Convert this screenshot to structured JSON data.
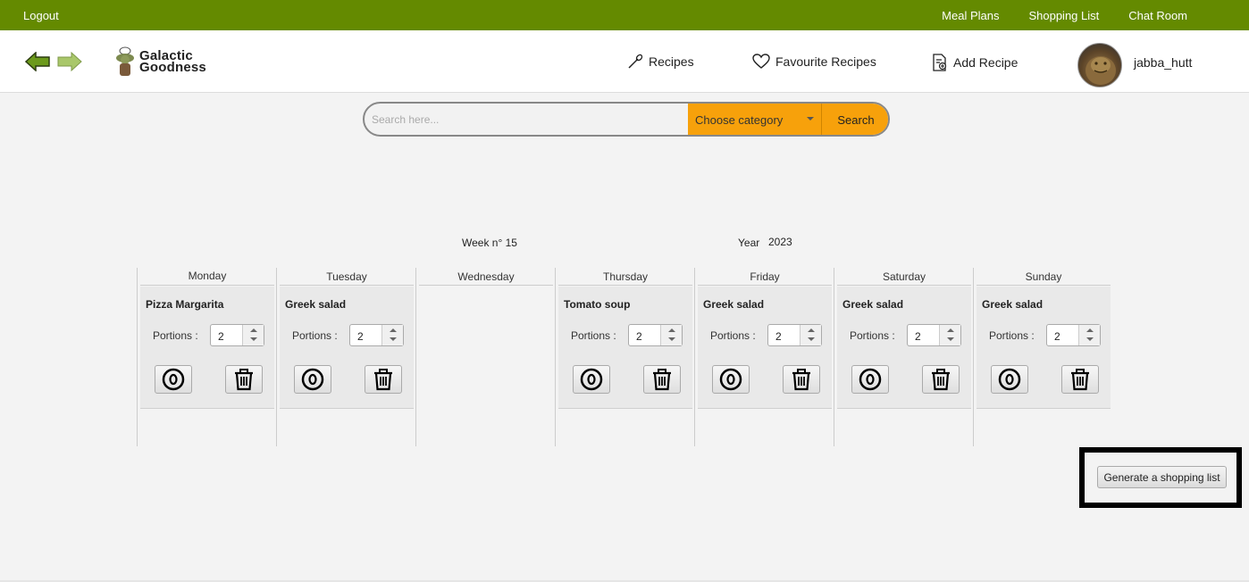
{
  "topbar": {
    "logout": "Logout",
    "menu": [
      "Meal Plans",
      "Shopping List",
      "Chat Room"
    ],
    "color": "#648a00"
  },
  "header": {
    "logo_line1": "Galactic",
    "logo_line2": "Goodness",
    "nav": {
      "recipes": "Recipes",
      "favourites": "Favourite Recipes",
      "add": "Add Recipe"
    },
    "username": "jabba_hutt"
  },
  "search": {
    "placeholder": "Search here...",
    "category": "Choose category",
    "button": "Search",
    "accent": "#f7a10b"
  },
  "week": {
    "week_label": "Week n° 15",
    "year_label": "Year",
    "year_value": "2023"
  },
  "days": [
    {
      "name": "Monday",
      "recipe": "Pizza Margarita",
      "portions_label": "Portions :",
      "portions": "2"
    },
    {
      "name": "Tuesday",
      "recipe": "Greek salad",
      "portions_label": "Portions :",
      "portions": "2"
    },
    {
      "name": "Wednesday"
    },
    {
      "name": "Thursday",
      "recipe": "Tomato soup",
      "portions_label": "Portions :",
      "portions": "2"
    },
    {
      "name": "Friday",
      "recipe": "Greek salad",
      "portions_label": "Portions :",
      "portions": "2"
    },
    {
      "name": "Saturday",
      "recipe": "Greek salad",
      "portions_label": "Portions :",
      "portions": "2"
    },
    {
      "name": "Sunday",
      "recipe": "Greek salad",
      "portions_label": "Portions :",
      "portions": "2"
    }
  ],
  "shopping": {
    "button": "Generate a shopping list"
  },
  "icons": [
    "back-arrow-icon",
    "forward-arrow-icon",
    "yoda-chef-logo-icon",
    "spoon-icon",
    "heart-icon",
    "add-recipe-icon",
    "view-eye-icon",
    "trash-icon"
  ]
}
